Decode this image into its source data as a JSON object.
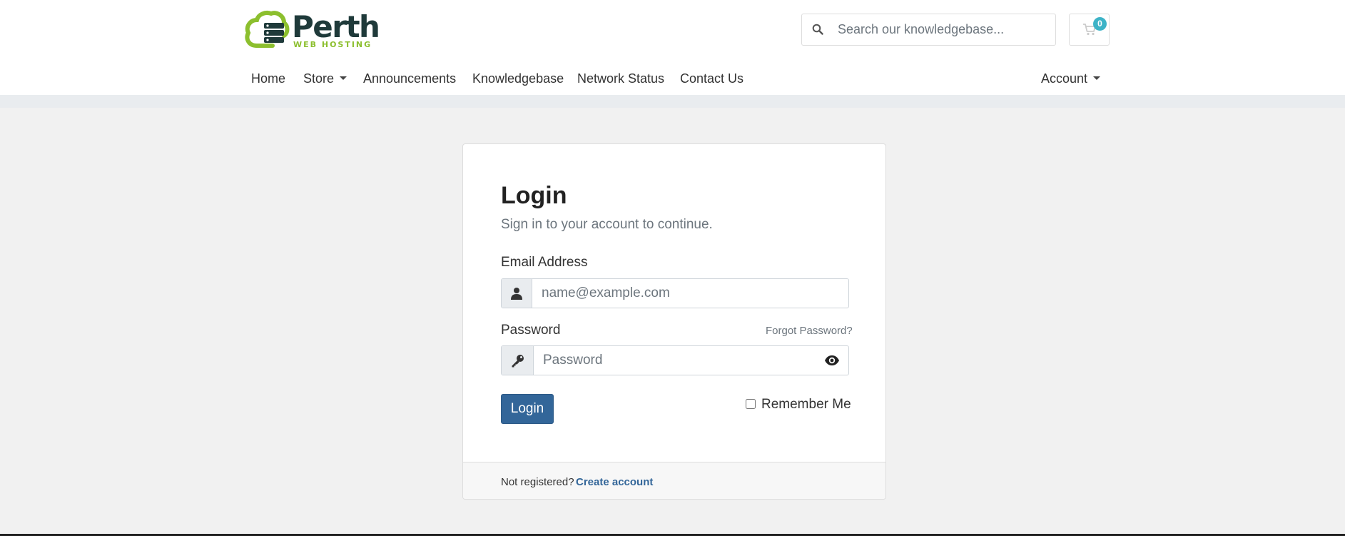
{
  "brand": {
    "name": "Perth",
    "tagline": "WEB HOSTING",
    "colors": {
      "primary": "#1f3a3a",
      "accent": "#8cbf2e"
    }
  },
  "search": {
    "placeholder": "Search our knowledgebase..."
  },
  "cart": {
    "count": "0",
    "icon": "cart-icon"
  },
  "nav": {
    "items": [
      {
        "label": "Home"
      },
      {
        "label": "Store"
      },
      {
        "label": "Announcements"
      },
      {
        "label": "Knowledgebase"
      },
      {
        "label": "Network Status"
      },
      {
        "label": "Contact Us"
      }
    ],
    "account": {
      "label": "Account"
    }
  },
  "login": {
    "title": "Login",
    "subtitle": "Sign in to your account to continue.",
    "email_label": "Email Address",
    "email_placeholder": "name@example.com",
    "password_label": "Password",
    "password_placeholder": "Password",
    "forgot_label": "Forgot Password?",
    "submit_label": "Login",
    "remember_label": "Remember Me",
    "remember_checked": false,
    "footer_text": "Not registered?",
    "footer_link": "Create account"
  },
  "colors": {
    "button": "#336699",
    "badge": "#3db3c7",
    "page_bg": "#f1f1f1"
  }
}
